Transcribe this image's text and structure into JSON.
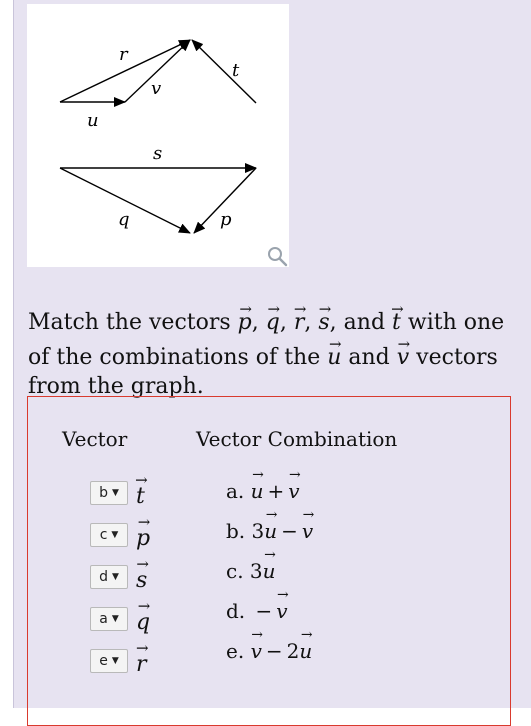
{
  "figure": {
    "labels": {
      "r": "r",
      "v": "v",
      "t": "t",
      "u": "u",
      "s": "s",
      "q": "q",
      "p": "p"
    }
  },
  "zoom_icon": "magnifier-icon",
  "question": {
    "prefix": "Match the vectors ",
    "vectors": [
      "p",
      "q",
      "r",
      "s",
      "t"
    ],
    "and1": ", and ",
    "line_mid": " with one of the combinations of the ",
    "u": "u",
    "and2": " and ",
    "v": "v",
    "suffix": " vectors from the graph."
  },
  "table": {
    "col_vector": "Vector",
    "col_combo": "Vector Combination",
    "rows": [
      {
        "selected": "b",
        "vector": "t"
      },
      {
        "selected": "c",
        "vector": "p"
      },
      {
        "selected": "d",
        "vector": "s"
      },
      {
        "selected": "a",
        "vector": "q"
      },
      {
        "selected": "e",
        "vector": "r"
      }
    ],
    "combinations": [
      {
        "letter": "a.",
        "c1": "",
        "v1": "u",
        "op": "+",
        "c2": "",
        "v2": "v"
      },
      {
        "letter": "b.",
        "c1": "3",
        "v1": "u",
        "op": "−",
        "c2": "",
        "v2": "v"
      },
      {
        "letter": "c.",
        "c1": "3",
        "v1": "u",
        "op": "",
        "c2": "",
        "v2": ""
      },
      {
        "letter": "d.",
        "c1": "",
        "v1": "",
        "op": "−",
        "c2": "",
        "v2": "v"
      },
      {
        "letter": "e.",
        "c1": "",
        "v1": "v",
        "op": "−",
        "c2": "2",
        "v2": "u"
      }
    ]
  },
  "colors": {
    "border": "#d93a2e",
    "panel": "#e7e3f1"
  }
}
